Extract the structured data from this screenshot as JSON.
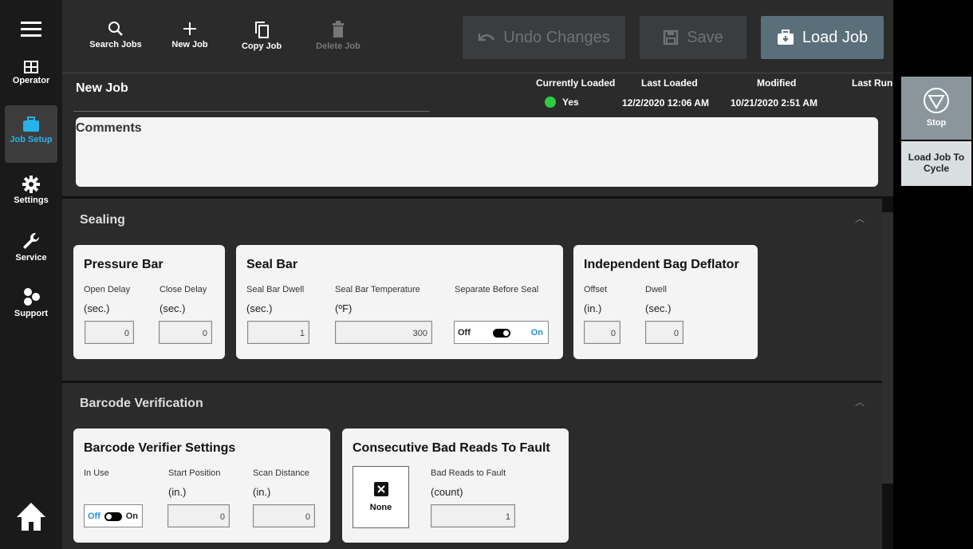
{
  "nav": {
    "operator": "Operator",
    "job_setup": "Job Setup",
    "settings": "Settings",
    "service": "Service",
    "support": "Support"
  },
  "toolbar": {
    "search_jobs": "Search Jobs",
    "new_job": "New Job",
    "copy_job": "Copy Job",
    "delete_job": "Delete Job",
    "undo_changes": "Undo Changes",
    "save": "Save",
    "load_job": "Load Job"
  },
  "header": {
    "job_name": "New Job",
    "currently_loaded_label": "Currently Loaded",
    "currently_loaded_value": "Yes",
    "last_loaded_label": "Last Loaded",
    "last_loaded_value": "12/2/2020 12:06 AM",
    "modified_label": "Modified",
    "modified_value": "10/21/2020 2:51 AM",
    "last_run_label": "Last Run"
  },
  "comments": {
    "title": "Comments"
  },
  "sealing": {
    "title": "Sealing",
    "pressure_bar": {
      "title": "Pressure Bar",
      "open_delay_label": "Open Delay",
      "open_delay_unit": "(sec.)",
      "open_delay_value": "0",
      "close_delay_label": "Close Delay",
      "close_delay_unit": "(sec.)",
      "close_delay_value": "0"
    },
    "seal_bar": {
      "title": "Seal Bar",
      "dwell_label": "Seal Bar Dwell",
      "dwell_unit": "(sec.)",
      "dwell_value": "1",
      "temp_label": "Seal Bar Temperature",
      "temp_unit": "(ºF)",
      "temp_value": "300",
      "separate_label": "Separate Before Seal",
      "toggle_off": "Off",
      "toggle_on": "On"
    },
    "deflator": {
      "title": "Independent Bag Deflator",
      "offset_label": "Offset",
      "offset_unit": "(in.)",
      "offset_value": "0",
      "dwell_label": "Dwell",
      "dwell_unit": "(sec.)",
      "dwell_value": "0"
    }
  },
  "barcode": {
    "title": "Barcode Verification",
    "verifier": {
      "title": "Barcode Verifier Settings",
      "in_use_label": "In Use",
      "toggle_off": "Off",
      "toggle_on": "On",
      "start_label": "Start Position",
      "start_unit": "(in.)",
      "start_value": "0",
      "scan_label": "Scan Distance",
      "scan_unit": "(in.)",
      "scan_value": "0"
    },
    "bad_reads": {
      "title": "Consecutive Bad Reads To Fault",
      "none_label": "None",
      "label": "Bad Reads to Fault",
      "unit": "(count)",
      "value": "1"
    }
  },
  "right": {
    "stop": "Stop",
    "load_job_to_cycle": "Load Job To Cycle"
  },
  "colors": {
    "accent_blue": "#26b3e8",
    "status_green": "#2ecc40",
    "load_job_bg": "#5a6f7a"
  }
}
